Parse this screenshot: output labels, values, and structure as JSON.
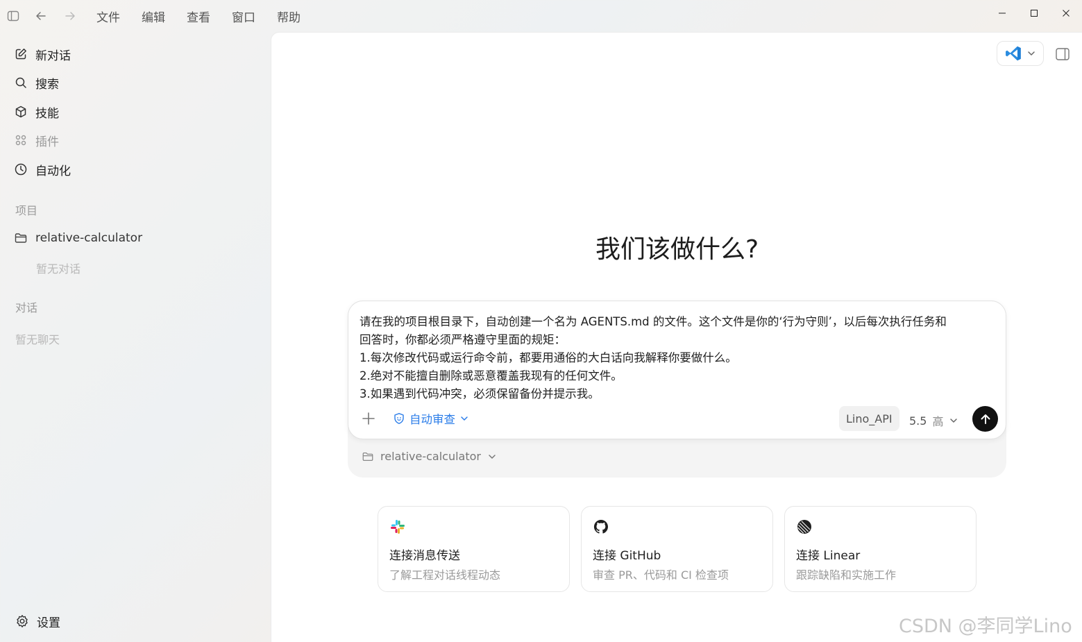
{
  "menu": [
    "文件",
    "编辑",
    "查看",
    "窗口",
    "帮助"
  ],
  "sidebar": {
    "nav": [
      {
        "label": "新对话",
        "icon": "edit-icon"
      },
      {
        "label": "搜索",
        "icon": "search-icon"
      },
      {
        "label": "技能",
        "icon": "cube-icon"
      },
      {
        "label": "插件",
        "icon": "grid-icon"
      },
      {
        "label": "自动化",
        "icon": "clock-icon"
      }
    ],
    "projects_title": "项目",
    "project_name": "relative-calculator",
    "project_empty": "暂无对话",
    "chats_title": "对话",
    "chats_empty": "暂无聊天",
    "settings": "设置"
  },
  "main": {
    "headline": "我们该做什么?",
    "prompt_lines": [
      "请在我的项目根目录下，自动创建一个名为 AGENTS.md 的文件。这个文件是你的‘行为守则’，以后每次执行任务和",
      "回答时，你都必须严格遵守里面的规矩：",
      "1.每次修改代码或运行命令前，都要用通俗的大白话向我解释你要做什么。",
      "2.绝对不能擅自删除或恶意覆盖我现有的任何文件。",
      "3.如果遇到代码冲突，必须保留备份并提示我。"
    ],
    "auto_review": "自动审查",
    "api_chip": "Lino_API",
    "model_version": "5.5",
    "model_effort": "高",
    "project_selector": "relative-calculator",
    "cards": [
      {
        "title": "连接消息传送",
        "desc": "了解工程对话线程动态",
        "icon": "slack-icon"
      },
      {
        "title": "连接 GitHub",
        "desc": "审查 PR、代码和 CI 检查项",
        "icon": "github-icon"
      },
      {
        "title": "连接 Linear",
        "desc": "跟踪缺陷和实施工作",
        "icon": "linear-icon"
      }
    ]
  },
  "watermark": "CSDN @李同学Lino",
  "colors": {
    "accent": "#2b7de9",
    "send": "#111111",
    "vscode": "#1e7fd6"
  }
}
